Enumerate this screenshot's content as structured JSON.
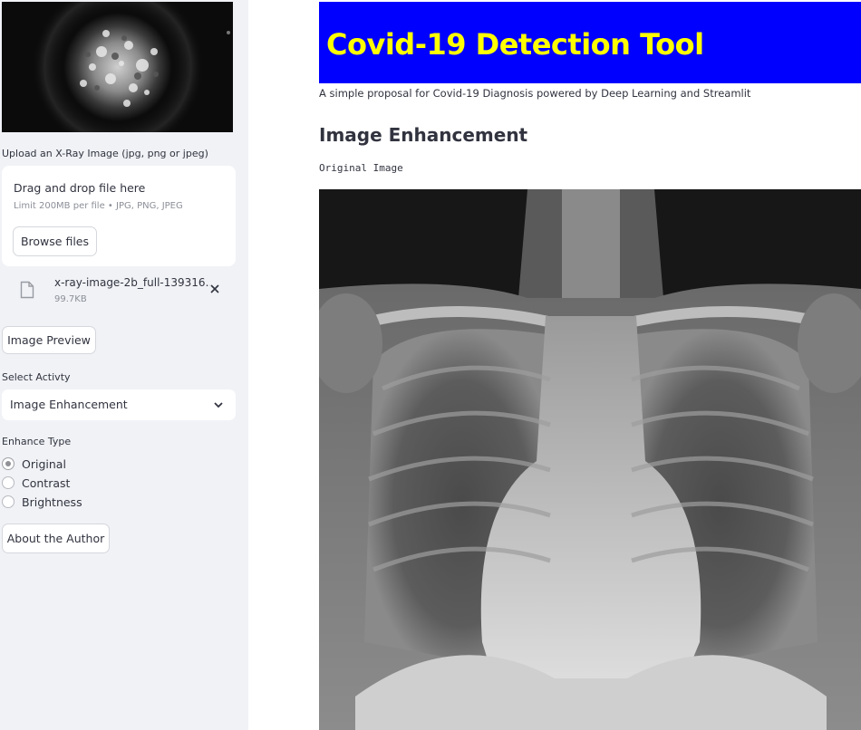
{
  "sidebar": {
    "upload_label": "Upload an X-Ray Image (jpg, png or jpeg)",
    "dropzone": {
      "title": "Drag and drop file here",
      "limit": "Limit 200MB per file • JPG, PNG, JPEG",
      "browse_label": "Browse files"
    },
    "uploaded_file": {
      "name": "x-ray-image-2b_full-139316…",
      "size": "99.7KB"
    },
    "preview_button": "Image Preview",
    "activity": {
      "label": "Select Activty",
      "selected": "Image Enhancement"
    },
    "enhance": {
      "label": "Enhance Type",
      "options": [
        "Original",
        "Contrast",
        "Brightness"
      ],
      "selected": "Original"
    },
    "about_button": "About the Author"
  },
  "main": {
    "title": "Covid-19 Detection Tool",
    "subtitle": "A simple proposal for Covid-19 Diagnosis powered by Deep Learning and Streamlit",
    "section_heading": "Image Enhancement",
    "image_caption": "Original Image"
  },
  "colors": {
    "banner_background": "#0000ff",
    "banner_text": "#ffff00",
    "sidebar_background": "#f0f2f6"
  },
  "icons": [
    "file-icon",
    "close-icon",
    "chevron-down-icon"
  ]
}
